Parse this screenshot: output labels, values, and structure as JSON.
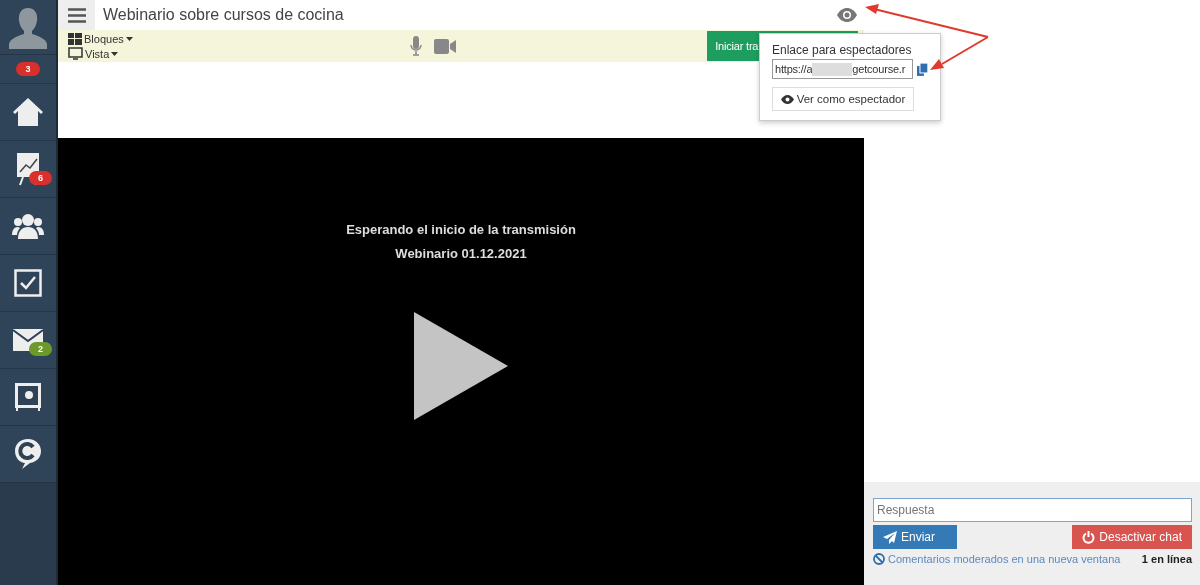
{
  "sidebar": {
    "items": [
      {
        "kind": "avatar"
      },
      {
        "kind": "badge-row",
        "badge": "3",
        "color": "#d9302c"
      },
      {
        "kind": "home"
      },
      {
        "kind": "chart",
        "badge": "6",
        "color": "#d9302c"
      },
      {
        "kind": "users"
      },
      {
        "kind": "tasks"
      },
      {
        "kind": "mail",
        "badge": "2",
        "color": "#6c9a2a"
      },
      {
        "kind": "safe"
      },
      {
        "kind": "chat"
      }
    ]
  },
  "header": {
    "title": "Webinario sobre cursos de cocina"
  },
  "toolbar": {
    "menus": [
      {
        "kind": "blocks",
        "label": "Bloques"
      },
      {
        "kind": "view",
        "label": "Vista"
      }
    ],
    "start_button": "Iniciar tra"
  },
  "popover": {
    "label": "Enlace para espectadores",
    "link_start": "https://a",
    "link_end": "getcourse.r",
    "view_button": "Ver como espectador"
  },
  "video": {
    "status": "Esperando el inicio de la transmisión",
    "name": "Webinario 01.12.2021"
  },
  "chat": {
    "placeholder": "Respuesta",
    "send": "Enviar",
    "disable": "Desactivar chat",
    "moderated_link": "Comentarios moderados en una nueva ventana",
    "online": "1 en línea"
  }
}
